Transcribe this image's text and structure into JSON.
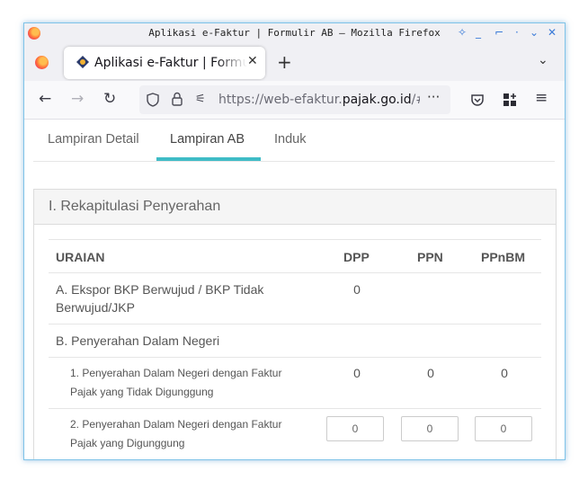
{
  "window": {
    "title": "Aplikasi e-Faktur | Formulir AB — Mozilla Firefox"
  },
  "browser": {
    "tab_title": "Aplikasi e-Faktur | Formulir AB",
    "url_prefix": "https://web-efaktur.",
    "url_domain": "pajak.go.id",
    "url_suffix": "/#/"
  },
  "page": {
    "tabs": [
      {
        "label": "Lampiran Detail",
        "active": false
      },
      {
        "label": "Lampiran AB",
        "active": true
      },
      {
        "label": "Induk",
        "active": false
      }
    ],
    "accent_color": "#3fbcc6",
    "section_title": "I. Rekapitulasi Penyerahan",
    "table": {
      "headers": {
        "uraian": "URAIAN",
        "dpp": "DPP",
        "ppn": "PPN",
        "ppnbm": "PPnBM"
      },
      "rows": [
        {
          "label": "A. Ekspor BKP Berwujud / BKP Tidak Berwujud/JKP",
          "dpp": "0",
          "ppn": "",
          "ppnbm": ""
        },
        {
          "label": "B. Penyerahan Dalam Negeri",
          "dpp": "",
          "ppn": "",
          "ppnbm": ""
        },
        {
          "label": "1. Penyerahan Dalam Negeri dengan Faktur Pajak yang Tidak Digunggung",
          "dpp": "0",
          "ppn": "0",
          "ppnbm": "0"
        },
        {
          "label": "2. Penyerahan Dalam Negeri dengan Faktur Pajak yang Digunggung",
          "dpp": "0",
          "ppn": "0",
          "ppnbm": "0"
        }
      ]
    }
  }
}
